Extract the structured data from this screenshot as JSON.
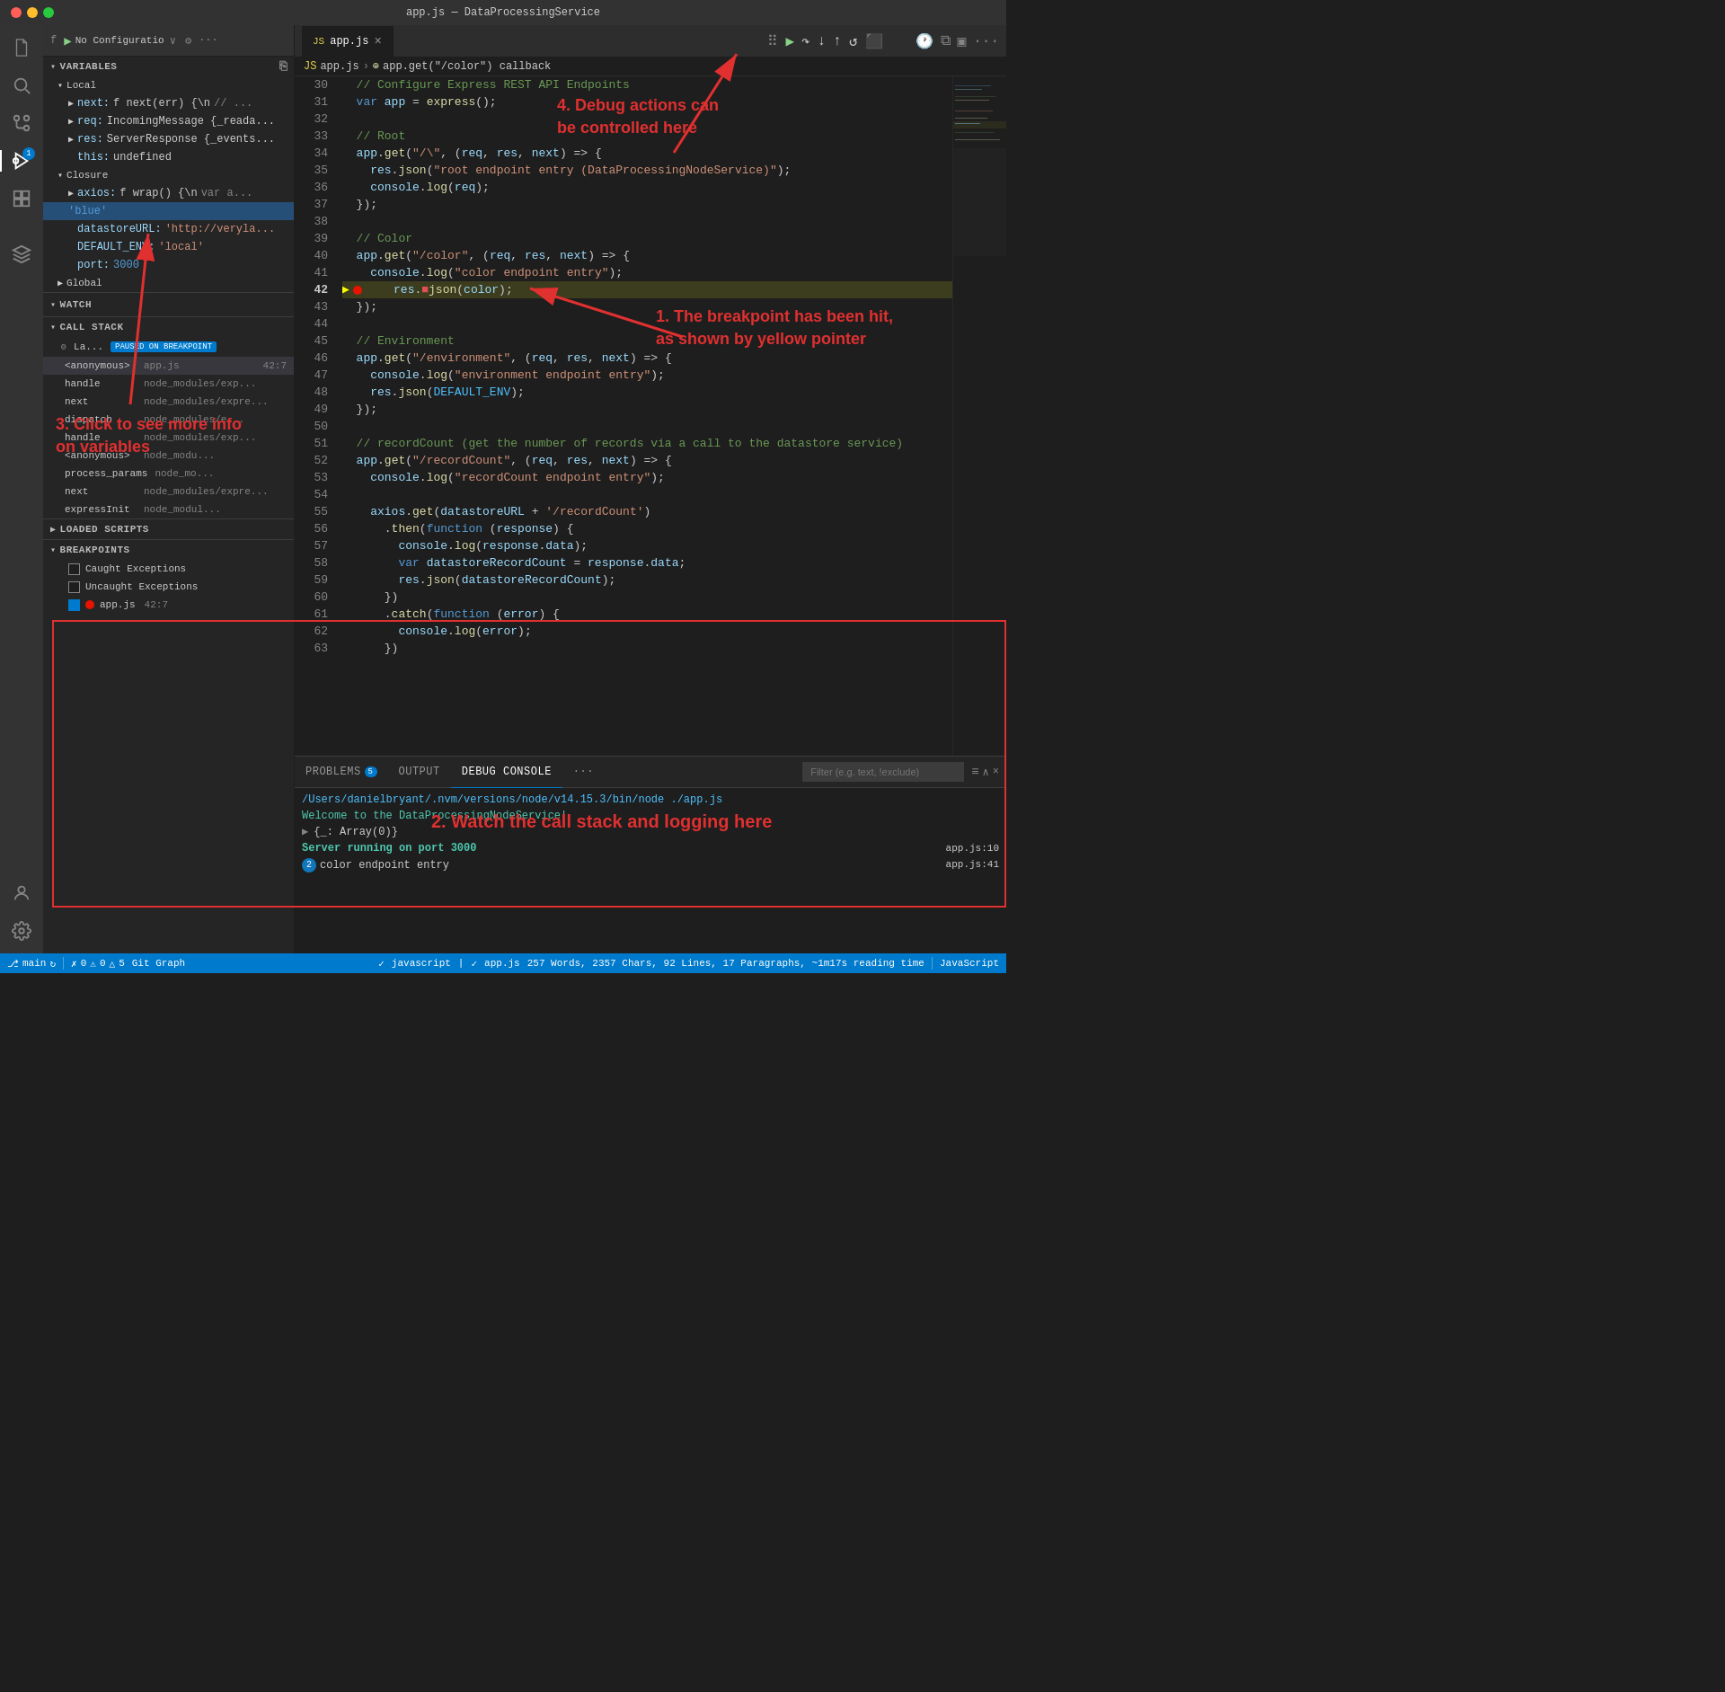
{
  "titleBar": {
    "title": "app.js — DataProcessingService"
  },
  "activityBar": {
    "icons": [
      {
        "name": "explorer-icon",
        "symbol": "⎘",
        "active": false
      },
      {
        "name": "search-icon",
        "symbol": "🔍",
        "active": false
      },
      {
        "name": "source-control-icon",
        "symbol": "⎇",
        "active": false
      },
      {
        "name": "debug-icon",
        "symbol": "▶",
        "active": true,
        "badge": "1"
      },
      {
        "name": "extensions-icon",
        "symbol": "⊞",
        "active": false
      },
      {
        "name": "remote-icon",
        "symbol": "◎",
        "active": false
      }
    ],
    "bottomIcons": [
      {
        "name": "settings-icon",
        "symbol": "⚙"
      },
      {
        "name": "account-icon",
        "symbol": "👤"
      }
    ]
  },
  "sidebar": {
    "debugToolbar": {
      "playLabel": "▶",
      "configLabel": "No Configuratio",
      "gearSymbol": "⚙",
      "moreSymbol": "···"
    },
    "variables": {
      "header": "VARIABLES",
      "local": {
        "label": "Local",
        "items": [
          {
            "name": "next:",
            "type": "f next(err) {\\n",
            "extra": "// ..."
          },
          {
            "name": "req:",
            "type": "IncomingMessage {_reada..."
          },
          {
            "name": "res:",
            "type": "ServerResponse {_events..."
          },
          {
            "name": "this:",
            "value": "undefined"
          }
        ]
      },
      "closure": {
        "label": "Closure",
        "items": [
          {
            "name": "axios:",
            "type": "f wrap() {\\n",
            "extra": "var a..."
          },
          {
            "name": "'blue'",
            "selected": true
          },
          {
            "name": "datastoreURL:",
            "value": "'http://veryla..."
          },
          {
            "name": "DEFAULT_ENV:",
            "value": "'local'"
          },
          {
            "name": "port:",
            "value": "3000"
          }
        ]
      },
      "global": {
        "label": "Global"
      }
    },
    "watch": {
      "header": "WATCH"
    },
    "callStack": {
      "header": "CALL STACK",
      "pausedLabel": "La...",
      "pausedBadge": "PAUSED ON BREAKPOINT",
      "items": [
        {
          "func": "<anonymous>",
          "file": "app.js",
          "position": "42:7",
          "active": true
        },
        {
          "func": "handle",
          "file": "node_modules/exp..."
        },
        {
          "func": "next",
          "file": "node_modules/expre..."
        },
        {
          "func": "dispatch",
          "file": "node_modules/e..."
        },
        {
          "func": "handle",
          "file": "node_modules/exp..."
        },
        {
          "func": "<anonymous>",
          "file": "node_modu..."
        },
        {
          "func": "process_params",
          "file": "node_mo..."
        },
        {
          "func": "next",
          "file": "node_modules/expre..."
        },
        {
          "func": "expressInit",
          "file": "node_modul..."
        }
      ]
    },
    "loadedScripts": {
      "header": "LOADED SCRIPTS"
    },
    "breakpoints": {
      "header": "BREAKPOINTS",
      "items": [
        {
          "label": "Caught Exceptions",
          "checked": false
        },
        {
          "label": "Uncaught Exceptions",
          "checked": false
        },
        {
          "label": "app.js",
          "checked": true,
          "dot": true,
          "position": "42:7"
        }
      ]
    }
  },
  "editor": {
    "tab": {
      "icon": "JS",
      "label": "app.js",
      "closeSymbol": "×"
    },
    "breadcrumb": {
      "file": "app.js",
      "separator": "›",
      "symbol": "⊕",
      "path": "app.get(\"/color\") callback"
    },
    "lines": [
      {
        "num": 30,
        "code": "  // Configure Express REST API Endpoints",
        "type": "comment"
      },
      {
        "num": 31,
        "code": "  var app = express();",
        "type": "code"
      },
      {
        "num": 32,
        "code": "",
        "type": "empty"
      },
      {
        "num": 33,
        "code": "  // Root",
        "type": "comment"
      },
      {
        "num": 34,
        "code": "  app.get(\"/\", (req, res, next) => {",
        "type": "code"
      },
      {
        "num": 35,
        "code": "    res.json(\"root endpoint entry (DataProcessingNodeService)\");",
        "type": "code"
      },
      {
        "num": 36,
        "code": "    console.log(req);",
        "type": "code"
      },
      {
        "num": 37,
        "code": "  });",
        "type": "code"
      },
      {
        "num": 38,
        "code": "",
        "type": "empty"
      },
      {
        "num": 39,
        "code": "  // Color",
        "type": "comment"
      },
      {
        "num": 40,
        "code": "  app.get(\"/color\", (req, res, next) => {",
        "type": "code"
      },
      {
        "num": 41,
        "code": "    console.log(\"color endpoint entry\");",
        "type": "code"
      },
      {
        "num": 42,
        "code": "    res.json(color);",
        "type": "current",
        "breakpoint": true
      },
      {
        "num": 43,
        "code": "  });",
        "type": "code"
      },
      {
        "num": 44,
        "code": "",
        "type": "empty"
      },
      {
        "num": 45,
        "code": "  // Environment",
        "type": "comment"
      },
      {
        "num": 46,
        "code": "  app.get(\"/environment\", (req, res, next) => {",
        "type": "code"
      },
      {
        "num": 47,
        "code": "    console.log(\"environment endpoint entry\");",
        "type": "code"
      },
      {
        "num": 48,
        "code": "    res.json(DEFAULT_ENV);",
        "type": "code"
      },
      {
        "num": 49,
        "code": "  });",
        "type": "code"
      },
      {
        "num": 50,
        "code": "",
        "type": "empty"
      },
      {
        "num": 51,
        "code": "  // recordCount (get the number of records via a call to the datastore service)",
        "type": "comment"
      },
      {
        "num": 52,
        "code": "  app.get(\"/recordCount\", (req, res, next) => {",
        "type": "code"
      },
      {
        "num": 53,
        "code": "    console.log(\"recordCount endpoint entry\");",
        "type": "code"
      },
      {
        "num": 54,
        "code": "",
        "type": "empty"
      },
      {
        "num": 55,
        "code": "    axios.get(datastoreURL + '/recordCount')",
        "type": "code"
      },
      {
        "num": 56,
        "code": "      .then(function (response) {",
        "type": "code"
      },
      {
        "num": 57,
        "code": "        console.log(response.data);",
        "type": "code"
      },
      {
        "num": 58,
        "code": "        var datastoreRecordCount = response.data;",
        "type": "code"
      },
      {
        "num": 59,
        "code": "        res.json(datastoreRecordCount);",
        "type": "code"
      },
      {
        "num": 60,
        "code": "      })",
        "type": "code"
      },
      {
        "num": 61,
        "code": "      .catch(function (error) {",
        "type": "code"
      },
      {
        "num": 62,
        "code": "        console.log(error);",
        "type": "code"
      },
      {
        "num": 63,
        "code": "      })",
        "type": "code"
      }
    ]
  },
  "bottomPanel": {
    "tabs": [
      {
        "label": "PROBLEMS",
        "badge": "5",
        "active": false
      },
      {
        "label": "OUTPUT",
        "active": false
      },
      {
        "label": "DEBUG CONSOLE",
        "active": true
      },
      {
        "label": "...",
        "active": false
      }
    ],
    "filterPlaceholder": "Filter (e.g. text, !exclude)",
    "consoleLines": [
      {
        "type": "path",
        "text": "/Users/danielbryant/.nvm/versions/node/v14.15.3/bin/node ./app.js"
      },
      {
        "type": "text",
        "text": "Welcome to the DataProcessingNodeService!"
      },
      {
        "type": "text",
        "text": "> {_: Array(0)}"
      },
      {
        "type": "bold",
        "text": "Server running on port 3000",
        "file": "app.js:10"
      },
      {
        "type": "count",
        "count": "2",
        "text": "color endpoint entry",
        "file": "app.js:41"
      }
    ]
  },
  "statusBar": {
    "branch": "main",
    "syncSymbol": "↻",
    "errors": "0",
    "warnings": "0",
    "info": "5",
    "gitGraph": "Git Graph",
    "language": "javascript",
    "filename": "app.js",
    "stats": "257 Words, 2357 Chars, 92 Lines, 17 Paragraphs, ~1m17s reading time",
    "langMode": "JavaScript"
  },
  "annotations": {
    "annotation1": "1. The breakpoint has been hit,\nas shown by yellow pointer",
    "annotation2": "2. Watch the call stack and logging here",
    "annotation3": "3. Click to see more info\non variables",
    "annotation4": "4. Debug actions can\nbe controlled here"
  },
  "debugActionBar": {
    "icons": [
      "▶▶",
      "↷",
      "↓",
      "↑",
      "↺",
      "⬛"
    ]
  }
}
